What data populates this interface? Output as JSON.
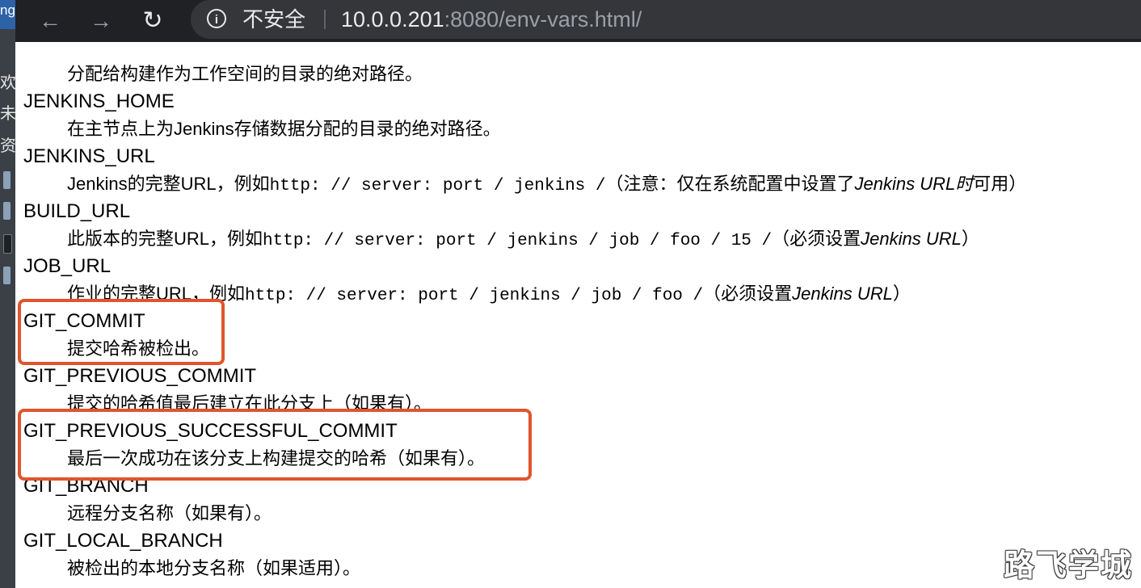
{
  "browser": {
    "back_glyph": "←",
    "forward_glyph": "→",
    "reload_glyph": "↻",
    "info_glyph": "i",
    "security_label": "不安全",
    "url_host": "10.0.0.201",
    "url_rest": ":8080/env-vars.html/",
    "icons": [
      "back-arrow-icon",
      "forward-arrow-icon",
      "reload-icon",
      "info-icon"
    ]
  },
  "left_strip": {
    "tab_fragment": "ng",
    "fragments": [
      "欢",
      "未",
      "资"
    ]
  },
  "env_vars": {
    "partial_top_desc": "分配给构建作为工作空间的目录的绝对路径。",
    "jenkins_home": {
      "name": "JENKINS_HOME",
      "desc": "在主节点上为Jenkins存储数据分配的目录的绝对路径。"
    },
    "jenkins_url": {
      "name": "JENKINS_URL",
      "desc_prefix": "Jenkins的完整URL，例如",
      "desc_code": "http: // server: port / jenkins /",
      "desc_middle": "（注意：仅在系统配置中设置了",
      "desc_em": "Jenkins URL时",
      "desc_suffix": "可用）"
    },
    "build_url": {
      "name": "BUILD_URL",
      "desc_prefix": "此版本的完整URL，例如",
      "desc_code": "http: // server: port / jenkins / job / foo / 15 /",
      "desc_middle": "（必须设置",
      "desc_em": "Jenkins URL",
      "desc_suffix": "）"
    },
    "job_url": {
      "name": "JOB_URL",
      "desc_prefix": "作业的完整URL，例如",
      "desc_code": "http: // server: port / jenkins / job / foo /",
      "desc_middle": "（必须设置",
      "desc_em": "Jenkins URL",
      "desc_suffix": "）"
    },
    "git_commit": {
      "name": "GIT_COMMIT",
      "desc": "提交哈希被检出。"
    },
    "git_previous_commit": {
      "name": "GIT_PREVIOUS_COMMIT",
      "desc": "提交的哈希值最后建立在此分支上（如果有）。"
    },
    "git_previous_successful_commit": {
      "name": "GIT_PREVIOUS_SUCCESSFUL_COMMIT",
      "desc": "最后一次成功在该分支上构建提交的哈希（如果有）。"
    },
    "git_branch": {
      "name": "GIT_BRANCH",
      "desc": "远程分支名称（如果有）。"
    },
    "git_local_branch": {
      "name": "GIT_LOCAL_BRANCH",
      "desc": "被检出的本地分支名称（如果适用）。"
    }
  },
  "highlight_color": "#e0552c",
  "watermark": "路飞学城"
}
